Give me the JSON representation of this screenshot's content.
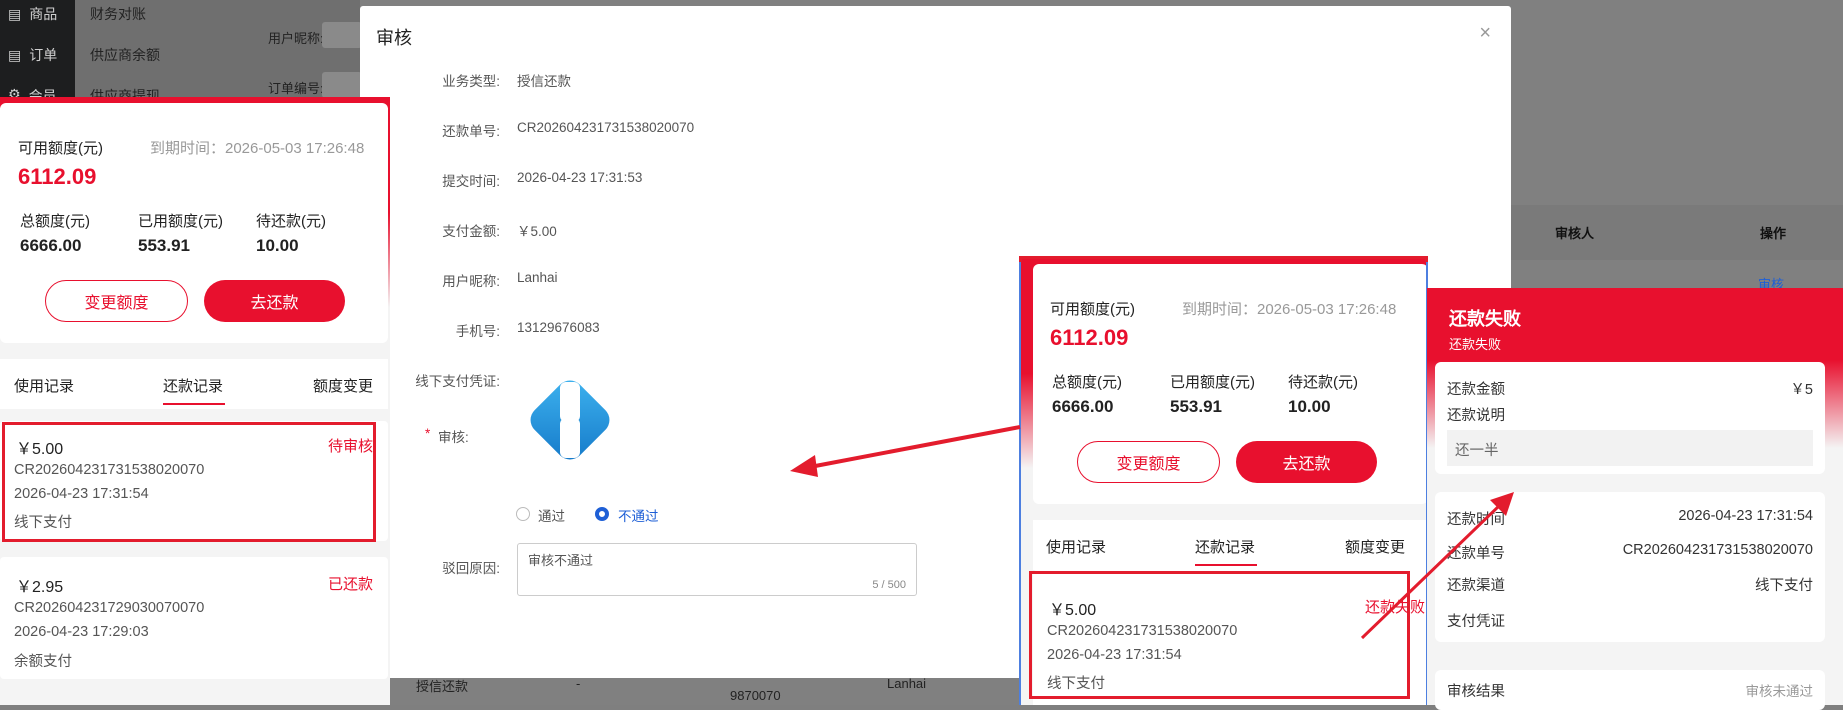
{
  "background": {
    "sidebar": {
      "items": [
        {
          "icon": "goods-icon",
          "label": "商品"
        },
        {
          "icon": "order-icon",
          "label": "订单"
        },
        {
          "icon": "member-icon",
          "label": "会员"
        }
      ]
    },
    "submenu": [
      "财务对账",
      "供应商余额",
      "供应商提现"
    ],
    "filters": {
      "nickname_label": "用户昵称:",
      "order_label": "订单编号:"
    },
    "table_headers": {
      "reviewer": "审核人",
      "action": "操作"
    },
    "row_action": "审核",
    "bottom_row": {
      "type": "授信还款",
      "dash": "-",
      "order_tail": "9870070",
      "nickname": "Lanhai"
    }
  },
  "modal": {
    "title": "审核",
    "close": "×",
    "fields": [
      {
        "label": "业务类型:",
        "value": "授信还款"
      },
      {
        "label": "还款单号:",
        "value": "CR202604231731538020070"
      },
      {
        "label": "提交时间:",
        "value": "2026-04-23 17:31:53"
      },
      {
        "label": "支付金额:",
        "value": "￥5.00"
      },
      {
        "label": "用户昵称:",
        "value": "Lanhai"
      },
      {
        "label": "手机号:",
        "value": "13129676083"
      }
    ],
    "voucher_label": "线下支付凭证:",
    "review": {
      "required_mark": "*",
      "label": "审核:",
      "options": [
        "通过",
        "不通过"
      ],
      "selected": "不通过"
    },
    "reject": {
      "label": "驳回原因:",
      "value": "审核不通过",
      "count": "5 / 500"
    }
  },
  "phone_left": {
    "available_label": "可用额度(元)",
    "expire_text": "到期时间：2026-05-03 17:26:48",
    "available_value": "6112.09",
    "stats": [
      {
        "label": "总额度(元)",
        "value": "6666.00"
      },
      {
        "label": "已用额度(元)",
        "value": "553.91"
      },
      {
        "label": "待还款(元)",
        "value": "10.00"
      }
    ],
    "btn_change": "变更额度",
    "btn_repay": "去还款",
    "tabs": [
      "使用记录",
      "还款记录",
      "额度变更"
    ],
    "records": [
      {
        "amount": "￥5.00",
        "status": "待审核",
        "order": "CR202604231731538020070",
        "time": "2026-04-23 17:31:54",
        "method": "线下支付"
      },
      {
        "amount": "￥2.95",
        "status": "已还款",
        "order": "CR202604231729030070070",
        "time": "2026-04-23 17:29:03",
        "method": "余额支付"
      }
    ]
  },
  "phone_right": {
    "available_label": "可用额度(元)",
    "expire_text": "到期时间：2026-05-03 17:26:48",
    "available_value": "6112.09",
    "stats": [
      {
        "label": "总额度(元)",
        "value": "6666.00"
      },
      {
        "label": "已用额度(元)",
        "value": "553.91"
      },
      {
        "label": "待还款(元)",
        "value": "10.00"
      }
    ],
    "btn_change": "变更额度",
    "btn_repay": "去还款",
    "tabs": [
      "使用记录",
      "还款记录",
      "额度变更"
    ],
    "record": {
      "amount": "￥5.00",
      "status": "还款失败",
      "order": "CR202604231731538020070",
      "time": "2026-04-23 17:31:54",
      "method": "线下支付"
    }
  },
  "detail": {
    "title": "还款失败",
    "subtitle": "还款失败",
    "amount_label": "还款金额",
    "amount_value": "￥5",
    "note_label": "还款说明",
    "note_value": "还一半",
    "time_label": "还款时间",
    "time_value": "2026-04-23 17:31:54",
    "order_label": "还款单号",
    "order_value": "CR202604231731538020070",
    "channel_label": "还款渠道",
    "channel_value": "线下支付",
    "voucher_label": "支付凭证",
    "result_label": "审核结果",
    "result_value": "审核未通过"
  },
  "colors": {
    "accent_red": "#e8102e",
    "annotation_red": "#e31c2d",
    "radio_blue": "#1e5fd6"
  }
}
